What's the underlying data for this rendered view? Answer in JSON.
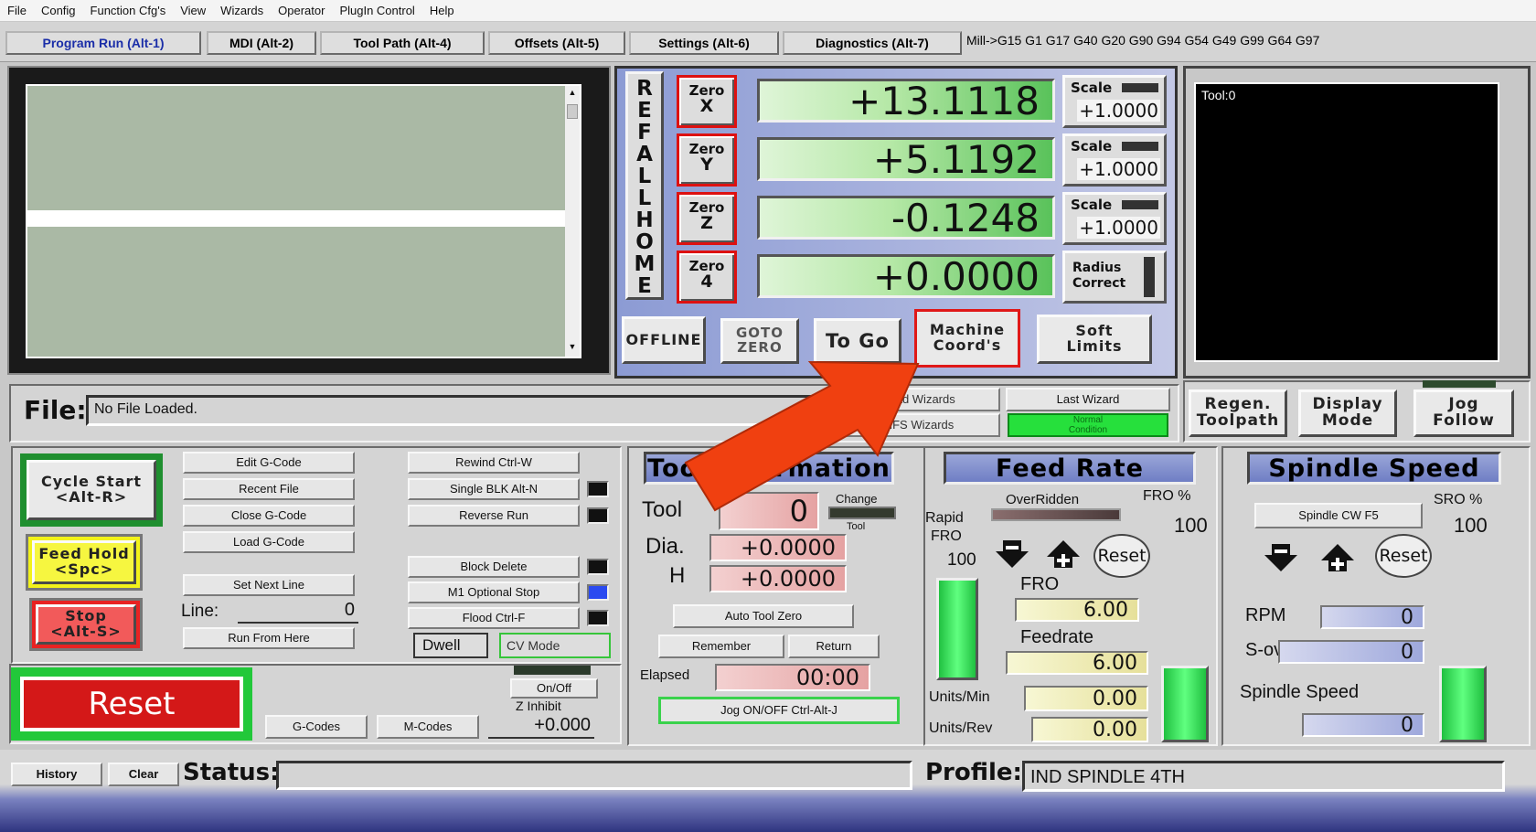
{
  "menu": [
    "File",
    "Config",
    "Function Cfg's",
    "View",
    "Wizards",
    "Operator",
    "PlugIn Control",
    "Help"
  ],
  "tabs": {
    "program_run": "Program Run (Alt-1)",
    "mdi": "MDI (Alt-2)",
    "tool_path": "Tool Path (Alt-4)",
    "offsets": "Offsets (Alt-5)",
    "settings": "Settings (Alt-6)",
    "diagnostics": "Diagnostics (Alt-7)"
  },
  "modal_codes": "Mill->G15  G1 G17 G40 G20 G90 G94 G54 G49 G99 G64 G97",
  "ref_all_home": [
    "R",
    "E",
    "F",
    "A",
    "L",
    "L",
    "H",
    "O",
    "M",
    "E"
  ],
  "axes": [
    {
      "zero_top": "Zero",
      "zero_axis": "X",
      "value": "+13.1118",
      "scale_label": "Scale",
      "scale": "+1.0000"
    },
    {
      "zero_top": "Zero",
      "zero_axis": "Y",
      "value": "+5.1192",
      "scale_label": "Scale",
      "scale": "+1.0000"
    },
    {
      "zero_top": "Zero",
      "zero_axis": "Z",
      "value": "-0.1248",
      "scale_label": "Scale",
      "scale": "+1.0000"
    },
    {
      "zero_top": "Zero",
      "zero_axis": "4",
      "value": "+0.0000"
    }
  ],
  "radius_correct": "Radius\nCorrect",
  "dro_buttons": {
    "offline": "OFFLINE",
    "goto_zero": "GOTO\nZERO",
    "to_go": "To Go",
    "machine_coords": "Machine\nCoord's",
    "soft_limits": "Soft\nLimits"
  },
  "tool_display": "Tool:0",
  "file": {
    "label": "File:",
    "value": "No File Loaded."
  },
  "wizards": {
    "load": "Load Wizards",
    "last": "Last Wizard",
    "nfs": "NFS Wizards",
    "status": "Normal\nCondition"
  },
  "view_buttons": {
    "regen": "Regen.\nToolpath",
    "display": "Display\nMode",
    "jog_follow": "Jog\nFollow"
  },
  "control": {
    "cycle_start": "Cycle Start\n<Alt-R>",
    "feed_hold": "Feed Hold\n<Spc>",
    "stop": "Stop\n<Alt-S>",
    "reset": "Reset"
  },
  "file_buttons": {
    "edit": "Edit G-Code",
    "recent": "Recent File",
    "close": "Close G-Code",
    "load": "Load G-Code",
    "set_next_line": "Set Next Line",
    "line_label": "Line:",
    "line_value": "0",
    "run_from_here": "Run From Here"
  },
  "run_buttons": {
    "rewind": "Rewind Ctrl-W",
    "single_blk": "Single BLK Alt-N",
    "reverse": "Reverse Run",
    "block_delete": "Block Delete",
    "m1": "M1 Optional Stop",
    "flood": "Flood Ctrl-F",
    "dwell": "Dwell",
    "cv_mode": "CV Mode"
  },
  "bottom_left": {
    "gcodes": "G-Codes",
    "mcodes": "M-Codes",
    "onoff": "On/Off",
    "z_inhibit": "Z Inhibit",
    "z_value": "+0.000"
  },
  "tool_info": {
    "title": "Tool Information",
    "tool_label": "Tool",
    "tool_value": "0",
    "change": "Change",
    "tool_small": "Tool",
    "dia_label": "Dia.",
    "dia_value": "+0.0000",
    "h_label": "H",
    "h_value": "+0.0000",
    "auto_tool_zero": "Auto Tool Zero",
    "remember": "Remember",
    "return": "Return",
    "elapsed_label": "Elapsed",
    "elapsed_value": "00:00",
    "jog": "Jog ON/OFF Ctrl-Alt-J"
  },
  "feed": {
    "title": "Feed Rate",
    "overridden": "OverRidden",
    "fro_pct": "FRO %",
    "fro_pct_value": "100",
    "rapid": "Rapid",
    "rapid_fro": "FRO",
    "rapid_value": "100",
    "reset": "Reset",
    "fro_label": "FRO",
    "fro_value": "6.00",
    "feedrate_label": "Feedrate",
    "feedrate_value": "6.00",
    "units_min_label": "Units/Min",
    "units_min_value": "0.00",
    "units_rev_label": "Units/Rev",
    "units_rev_value": "0.00"
  },
  "spindle": {
    "title": "Spindle Speed",
    "cw": "Spindle CW F5",
    "sro_pct": "SRO %",
    "sro_value": "100",
    "reset": "Reset",
    "rpm_label": "RPM",
    "rpm_value": "0",
    "sov_label": "S-ov",
    "sov_value": "0",
    "speed_label": "Spindle Speed",
    "speed_value": "0"
  },
  "status_bar": {
    "history": "History",
    "clear": "Clear",
    "status_label": "Status:",
    "status_value": "",
    "profile_label": "Profile:",
    "profile_value": "IND SPINDLE 4TH"
  },
  "colors": {
    "arrow": "#f04010",
    "dro_green": "#59c25a",
    "reset_red": "#d41818",
    "title_blue": "#7f8cc9"
  }
}
